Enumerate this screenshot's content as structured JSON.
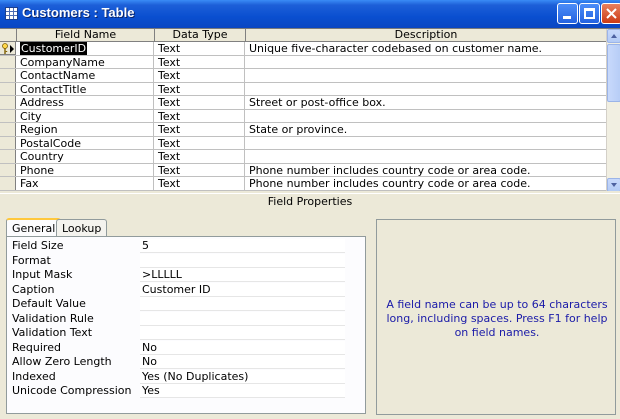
{
  "window": {
    "title": "Customers : Table"
  },
  "grid": {
    "headers": {
      "field_name": "Field Name",
      "data_type": "Data Type",
      "description": "Description"
    },
    "rows": [
      {
        "name": "CustomerID",
        "type": "Text",
        "desc": "Unique five-character codebased on customer name."
      },
      {
        "name": "CompanyName",
        "type": "Text",
        "desc": ""
      },
      {
        "name": "ContactName",
        "type": "Text",
        "desc": ""
      },
      {
        "name": "ContactTitle",
        "type": "Text",
        "desc": ""
      },
      {
        "name": "Address",
        "type": "Text",
        "desc": "Street or post-office box."
      },
      {
        "name": "City",
        "type": "Text",
        "desc": ""
      },
      {
        "name": "Region",
        "type": "Text",
        "desc": "State or province."
      },
      {
        "name": "PostalCode",
        "type": "Text",
        "desc": ""
      },
      {
        "name": "Country",
        "type": "Text",
        "desc": ""
      },
      {
        "name": "Phone",
        "type": "Text",
        "desc": "Phone number includes country code or area code."
      },
      {
        "name": "Fax",
        "type": "Text",
        "desc": "Phone number includes country code or area code."
      }
    ]
  },
  "field_properties": {
    "label": "Field Properties",
    "tabs": {
      "general": "General",
      "lookup": "Lookup"
    },
    "properties": [
      {
        "label": "Field Size",
        "value": "5"
      },
      {
        "label": "Format",
        "value": ""
      },
      {
        "label": "Input Mask",
        "value": ">LLLLL"
      },
      {
        "label": "Caption",
        "value": "Customer ID"
      },
      {
        "label": "Default Value",
        "value": ""
      },
      {
        "label": "Validation Rule",
        "value": ""
      },
      {
        "label": "Validation Text",
        "value": ""
      },
      {
        "label": "Required",
        "value": "No"
      },
      {
        "label": "Allow Zero Length",
        "value": "No"
      },
      {
        "label": "Indexed",
        "value": "Yes (No Duplicates)"
      },
      {
        "label": "Unicode Compression",
        "value": "Yes"
      }
    ],
    "hint": "A field name can be up to 64 characters long, including spaces.  Press F1 for help on field names."
  }
}
